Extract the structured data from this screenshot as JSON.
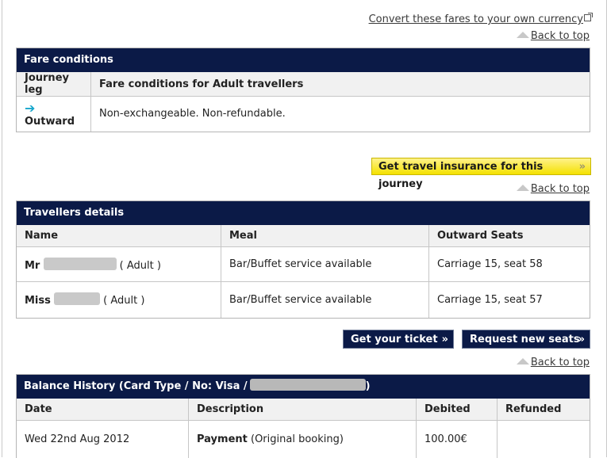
{
  "links": {
    "convert": "Convert these fares to your own currency",
    "back_to_top": "Back to top"
  },
  "fare": {
    "title": "Fare conditions",
    "col_leg": "Journey leg",
    "col_conditions": "Fare conditions for Adult travellers",
    "leg": "Outward",
    "conditions": "Non-exchangeable. Non-refundable."
  },
  "insurance_button": "Get travel insurance for this journey",
  "travellers": {
    "title": "Travellers details",
    "columns": [
      "Name",
      "Meal",
      "Outward Seats"
    ],
    "rows": [
      {
        "title": "Mr",
        "type": "( Adult )",
        "meal": "Bar/Buffet service available",
        "seat": "Carriage 15, seat 58"
      },
      {
        "title": "Miss",
        "type": "( Adult )",
        "meal": "Bar/Buffet service available",
        "seat": "Carriage 15, seat 57"
      }
    ]
  },
  "buttons": {
    "ticket": "Get your ticket",
    "seats": "Request new seats"
  },
  "balance": {
    "title_prefix": "Balance History (Card Type / No: Visa /",
    "title_suffix": ")",
    "columns": [
      "Date",
      "Description",
      "Debited",
      "Refunded"
    ],
    "rows": [
      {
        "date": "Wed 22nd Aug 2012",
        "desc_bold": "Payment",
        "desc_rest": " (Original booking)",
        "debited": "100.00€",
        "refunded": ""
      }
    ]
  },
  "colors": {
    "header_navy": "#0b1a47",
    "button_yellow": "#f4e100",
    "arrow_teal": "#17a7cc"
  }
}
